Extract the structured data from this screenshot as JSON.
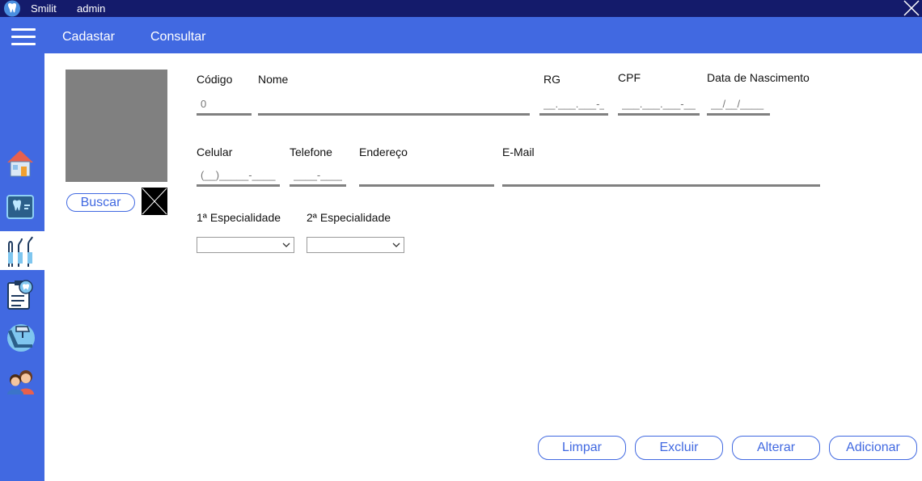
{
  "titlebar": {
    "app_name": "Smilit",
    "user": "admin",
    "app_icon": "tooth-icon",
    "close_icon": "close-icon"
  },
  "menubar": {
    "menu_icon": "hamburger-icon",
    "items": [
      {
        "label": "Cadastar"
      },
      {
        "label": "Consultar"
      }
    ]
  },
  "sidebar": {
    "items": [
      {
        "icon": "house-icon"
      },
      {
        "icon": "tooth-xray-icon"
      },
      {
        "icon": "dental-tools-icon",
        "active": true
      },
      {
        "icon": "dental-clipboard-icon"
      },
      {
        "icon": "dental-chair-icon"
      },
      {
        "icon": "people-icon"
      }
    ]
  },
  "photo": {
    "search_label": "Buscar",
    "clear_icon": "clear-image-icon"
  },
  "form": {
    "codigo": {
      "label": "Código",
      "value": "0"
    },
    "nome": {
      "label": "Nome",
      "value": ""
    },
    "rg": {
      "label": "RG",
      "placeholder": "__.___.___-_"
    },
    "cpf": {
      "label": "CPF",
      "placeholder": "___.___.___-__"
    },
    "nascimento": {
      "label": "Data de Nascimento",
      "placeholder": "__/__/____"
    },
    "celular": {
      "label": "Celular",
      "placeholder": "(__)_____-____"
    },
    "telefone": {
      "label": "Telefone",
      "placeholder": "____-____"
    },
    "endereco": {
      "label": "Endereço",
      "value": ""
    },
    "email": {
      "label": "E-Mail",
      "value": ""
    },
    "especialidade1": {
      "label": "1ª Especialidade",
      "selected": ""
    },
    "especialidade2": {
      "label": "2ª Especialidade",
      "selected": ""
    }
  },
  "actions": {
    "limpar": "Limpar",
    "excluir": "Excluir",
    "alterar": "Alterar",
    "adicionar": "Adicionar"
  },
  "colors": {
    "titlebar": "#141b6b",
    "accent": "#4169e1",
    "photo_placeholder": "#808080",
    "field_underline": "#808080"
  }
}
